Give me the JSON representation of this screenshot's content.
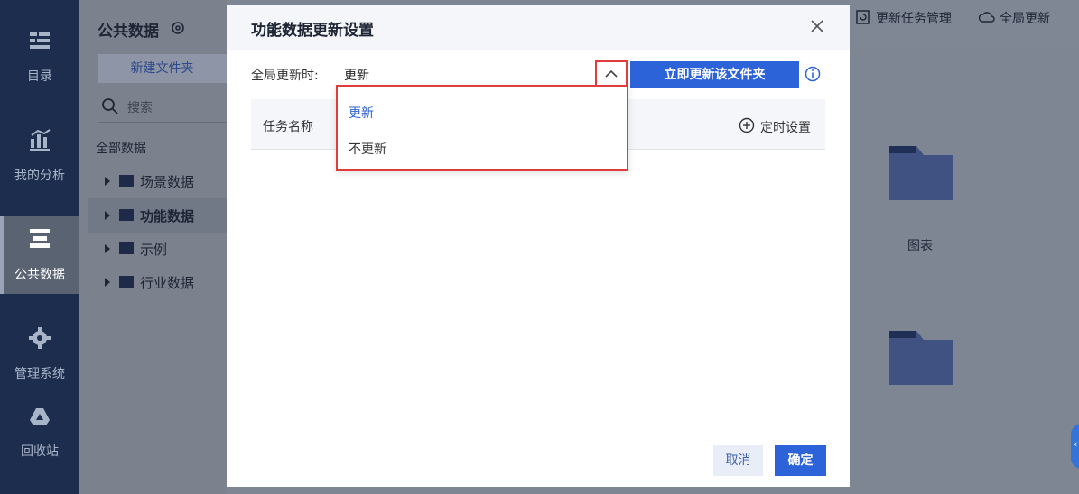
{
  "rail": {
    "items": [
      {
        "label": "目录",
        "icon": "catalog-icon"
      },
      {
        "label": "我的分析",
        "icon": "analysis-chart-icon"
      },
      {
        "label": "公共数据",
        "icon": "public-data-icon"
      },
      {
        "label": "管理系统",
        "icon": "gear-icon"
      },
      {
        "label": "回收站",
        "icon": "recycle-drive-icon"
      }
    ],
    "active_index": 2
  },
  "panel": {
    "title": "公共数据",
    "new_folder": "新建文件夹",
    "search_placeholder": "搜索",
    "all_data": "全部数据",
    "tree": [
      "场景数据",
      "功能数据",
      "示例",
      "行业数据"
    ],
    "selected_index": 1
  },
  "topbar": {
    "task_manage": "更新任务管理",
    "global_update": "全局更新"
  },
  "content": {
    "folder_label": "图表"
  },
  "modal": {
    "title": "功能数据更新设置",
    "global_label": "全局更新时:",
    "select_value": "更新",
    "update_now": "立即更新该文件夹",
    "table": {
      "col_name": "任务名称",
      "timer_label": "定时设置"
    },
    "dropdown_options": [
      "更新",
      "不更新"
    ],
    "selected_option": "更新",
    "cancel": "取消",
    "confirm": "确定"
  },
  "colors": {
    "primary": "#2d63d8",
    "highlight_border": "#e03c3c",
    "rail_bg": "#1d2d4d"
  }
}
